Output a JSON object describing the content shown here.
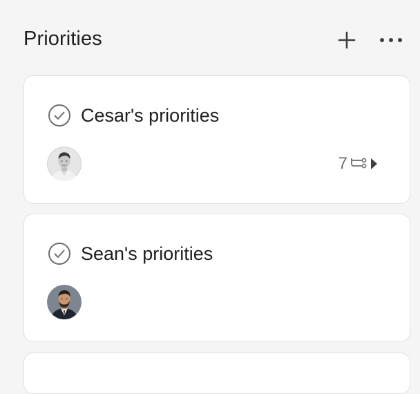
{
  "header": {
    "title": "Priorities",
    "add_icon": "plus-icon",
    "more_icon": "ellipsis-icon"
  },
  "cards": [
    {
      "title": "Cesar's priorities",
      "status_icon": "check-circle-icon",
      "avatar": "avatar-cesar",
      "subtask_count": "7",
      "subtask_icon": "subtask-icon",
      "expand_icon": "caret-right-icon"
    },
    {
      "title": "Sean's priorities",
      "status_icon": "check-circle-icon",
      "avatar": "avatar-sean"
    }
  ],
  "colors": {
    "background": "#f5f5f5",
    "card": "#ffffff",
    "border": "#e0e0e0",
    "text": "#1e1f21",
    "muted": "#6d6e6f"
  }
}
